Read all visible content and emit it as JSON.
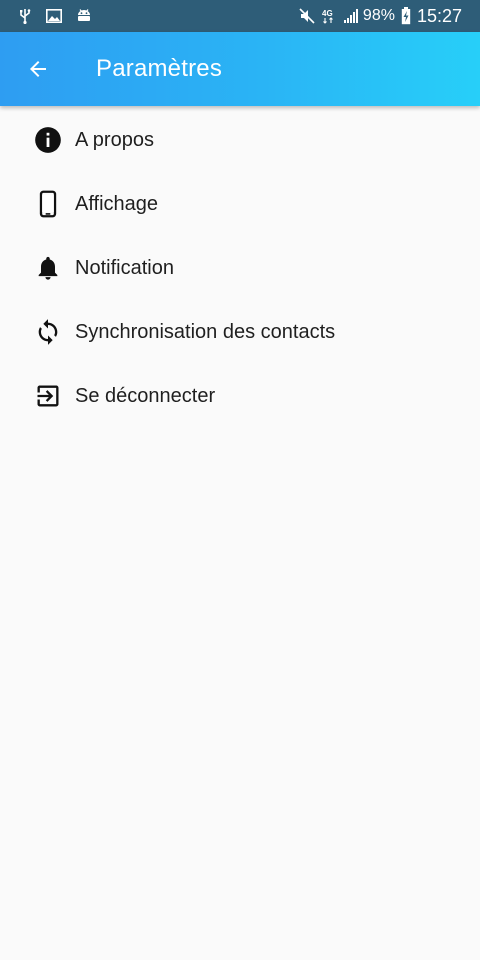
{
  "status_bar": {
    "battery": "98%",
    "time": "15:27",
    "left_icons": [
      "usb-icon",
      "image-icon",
      "android-icon"
    ],
    "right_icons": [
      "mute-icon",
      "4g-icon",
      "signal-icon",
      "battery-charging-icon"
    ],
    "network_badge": "4G"
  },
  "app_bar": {
    "title": "Paramètres",
    "back_icon": "arrow-back-icon"
  },
  "settings": {
    "items": [
      {
        "label": "A propos",
        "icon": "info-icon"
      },
      {
        "label": "Affichage",
        "icon": "phone-icon"
      },
      {
        "label": "Notification",
        "icon": "bell-icon"
      },
      {
        "label": "Synchronisation des contacts",
        "icon": "sync-icon"
      },
      {
        "label": "Se déconnecter",
        "icon": "logout-icon"
      }
    ]
  },
  "colors": {
    "status_bar": "#2e5d78",
    "app_bar_start": "#2e9df2",
    "app_bar_end": "#27cff9",
    "background": "#fafafa",
    "text": "#1f1f1f"
  }
}
